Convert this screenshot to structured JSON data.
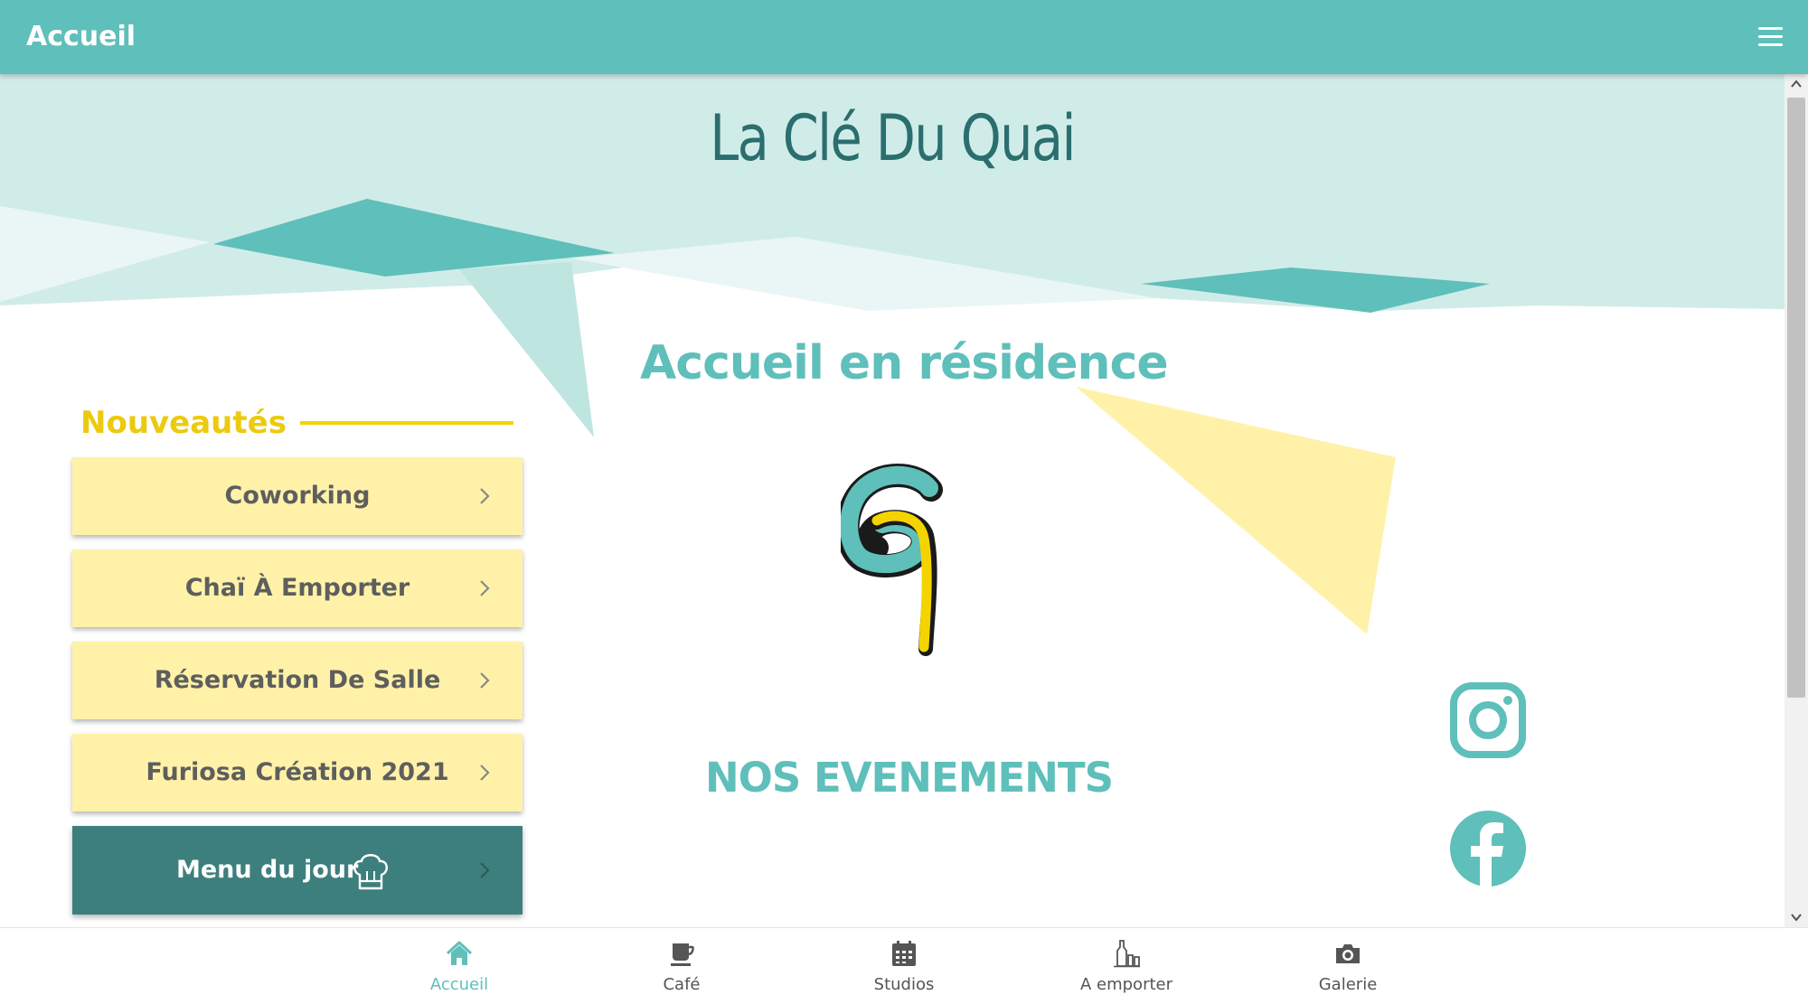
{
  "topbar": {
    "title": "Accueil",
    "menu_icon": "hamburger-menu-icon"
  },
  "hero": {
    "site_title": "La Clé Du Quai"
  },
  "residence": {
    "heading": "Accueil en résidence"
  },
  "news": {
    "heading": "Nouveautés",
    "items": [
      {
        "label": "Coworking",
        "icon": "chevron-right-icon"
      },
      {
        "label": "Chaï À Emporter",
        "icon": "chevron-right-icon"
      },
      {
        "label": "Réservation De Salle",
        "icon": "chevron-right-icon"
      },
      {
        "label": "Furiosa Création 2021",
        "icon": "chevron-right-icon"
      }
    ],
    "menu_du_jour": {
      "label": "Menu du jour",
      "icon": "chef-hat-icon"
    }
  },
  "events": {
    "heading": "NOS EVENEMENTS"
  },
  "social": {
    "instagram_icon": "instagram-icon",
    "facebook_icon": "facebook-icon"
  },
  "bottom_nav": {
    "tabs": [
      {
        "label": "Accueil",
        "icon": "home-icon",
        "active": true
      },
      {
        "label": "Café",
        "icon": "coffee-cup-icon",
        "active": false
      },
      {
        "label": "Studios",
        "icon": "calendar-icon",
        "active": false
      },
      {
        "label": "A emporter",
        "icon": "bottles-icon",
        "active": false
      },
      {
        "label": "Galerie",
        "icon": "camera-icon",
        "active": false
      }
    ]
  },
  "colors": {
    "brand_teal": "#5fbfba",
    "dark_teal": "#3d7f7d",
    "title_teal": "#2b6e6e",
    "pale_yellow": "#fff2a8",
    "accent_yellow": "#f4d400"
  }
}
